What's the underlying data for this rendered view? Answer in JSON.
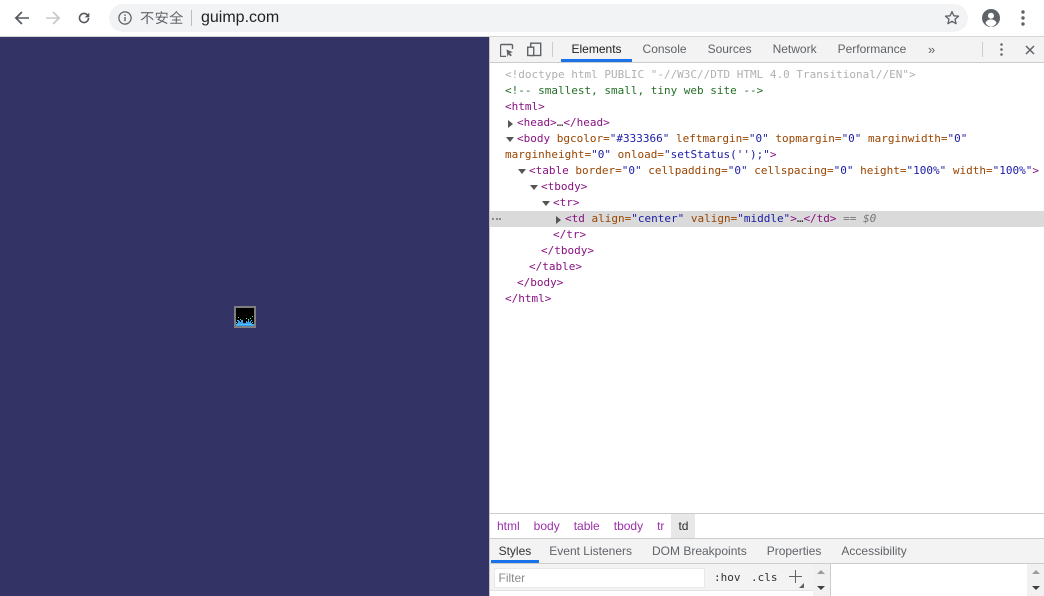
{
  "colors": {
    "accent": "#1a73e8",
    "page_bg": "#333366",
    "selection_bg": "#dadada"
  },
  "browser": {
    "back_icon": "arrow-left",
    "forward_icon": "arrow-right",
    "reload_icon": "refresh",
    "omnibox": {
      "info_icon": "info-circle",
      "security_label": "不安全",
      "url": "guimp.com",
      "bookmark_icon": "star-outline"
    },
    "avatar_icon": "profile-person",
    "menu_icon": "kebab-vertical"
  },
  "devtools": {
    "toolbar": {
      "inspect_icon": "inspect-cursor",
      "device_icon": "device-toolbar",
      "tabs": [
        {
          "label": "Elements",
          "active": true
        },
        {
          "label": "Console",
          "active": false
        },
        {
          "label": "Sources",
          "active": false
        },
        {
          "label": "Network",
          "active": false
        },
        {
          "label": "Performance",
          "active": false
        }
      ],
      "more_tabs_label": "»",
      "menu_icon": "kebab-vertical",
      "close_icon": "close-x"
    },
    "tree": {
      "rows": [
        {
          "i": 0,
          "s": [
            [
              "dt",
              "<!doctype html PUBLIC \"-//W3C//DTD HTML 4.0 Transitional//EN\">"
            ]
          ]
        },
        {
          "i": 0,
          "s": [
            [
              "cm",
              "<!-- smallest, small, tiny web site -->"
            ]
          ]
        },
        {
          "i": 0,
          "s": [
            [
              "tg",
              "<html>"
            ]
          ]
        },
        {
          "i": 1,
          "a": "closed",
          "s": [
            [
              "tg",
              "<head>"
            ],
            [
              "tx",
              "…"
            ],
            [
              "tg",
              "</head>"
            ]
          ]
        },
        {
          "i": 1,
          "a": "open",
          "s": [
            [
              "tg",
              "<body"
            ],
            [
              "at",
              " bgcolor="
            ],
            [
              "av",
              "\"#333366\""
            ],
            [
              "at",
              " leftmargin="
            ],
            [
              "av",
              "\"0\""
            ],
            [
              "at",
              " topmargin="
            ],
            [
              "av",
              "\"0\""
            ],
            [
              "at",
              " marginwidth="
            ],
            [
              "av",
              "\"0\""
            ]
          ]
        },
        {
          "i": 0,
          "s": [
            [
              "at",
              "marginheight="
            ],
            [
              "av",
              "\"0\""
            ],
            [
              "at",
              " onload="
            ],
            [
              "av",
              "\"setStatus('');\""
            ],
            [
              "tg",
              ">"
            ]
          ]
        },
        {
          "i": 2,
          "a": "open",
          "s": [
            [
              "tg",
              "<table"
            ],
            [
              "at",
              " border="
            ],
            [
              "av",
              "\"0\""
            ],
            [
              "at",
              " cellpadding="
            ],
            [
              "av",
              "\"0\""
            ],
            [
              "at",
              " cellspacing="
            ],
            [
              "av",
              "\"0\""
            ],
            [
              "at",
              " height="
            ],
            [
              "av",
              "\"100%\""
            ],
            [
              "at",
              " width="
            ],
            [
              "av",
              "\"100%\""
            ],
            [
              "tg",
              ">"
            ]
          ]
        },
        {
          "i": 3,
          "a": "open",
          "s": [
            [
              "tg",
              "<tbody>"
            ]
          ]
        },
        {
          "i": 4,
          "a": "open",
          "s": [
            [
              "tg",
              "<tr>"
            ]
          ]
        },
        {
          "i": 5,
          "a": "closed",
          "sel": true,
          "gut": true,
          "s": [
            [
              "tg",
              "<td"
            ],
            [
              "at",
              " align="
            ],
            [
              "av",
              "\"center\""
            ],
            [
              "at",
              " valign="
            ],
            [
              "av",
              "\"middle\""
            ],
            [
              "tg",
              ">"
            ],
            [
              "tx",
              "…"
            ],
            [
              "tg",
              "</td>"
            ],
            [
              "mt",
              " == $0"
            ]
          ]
        },
        {
          "i": 4,
          "s": [
            [
              "tg",
              "</tr>"
            ]
          ]
        },
        {
          "i": 3,
          "s": [
            [
              "tg",
              "</tbody>"
            ]
          ]
        },
        {
          "i": 2,
          "s": [
            [
              "tg",
              "</table>"
            ]
          ]
        },
        {
          "i": 1,
          "s": [
            [
              "tg",
              "</body>"
            ]
          ]
        },
        {
          "i": 0,
          "s": [
            [
              "tg",
              "</html>"
            ]
          ]
        }
      ]
    },
    "breadcrumbs": [
      {
        "label": "html",
        "selected": false
      },
      {
        "label": "body",
        "selected": false
      },
      {
        "label": "table",
        "selected": false
      },
      {
        "label": "tbody",
        "selected": false
      },
      {
        "label": "tr",
        "selected": false
      },
      {
        "label": "td",
        "selected": true
      }
    ],
    "sidebar_tabs": [
      {
        "label": "Styles",
        "active": true
      },
      {
        "label": "Event Listeners",
        "active": false
      },
      {
        "label": "DOM Breakpoints",
        "active": false
      },
      {
        "label": "Properties",
        "active": false
      },
      {
        "label": "Accessibility",
        "active": false
      }
    ],
    "styles_pane": {
      "filter_placeholder": "Filter",
      "pseudo_state_button": ":hov",
      "class_button": ".cls",
      "new_rule_button": "+",
      "scrollbar_icons": [
        "scroll-up-arrow",
        "scroll-down-arrow"
      ]
    }
  }
}
